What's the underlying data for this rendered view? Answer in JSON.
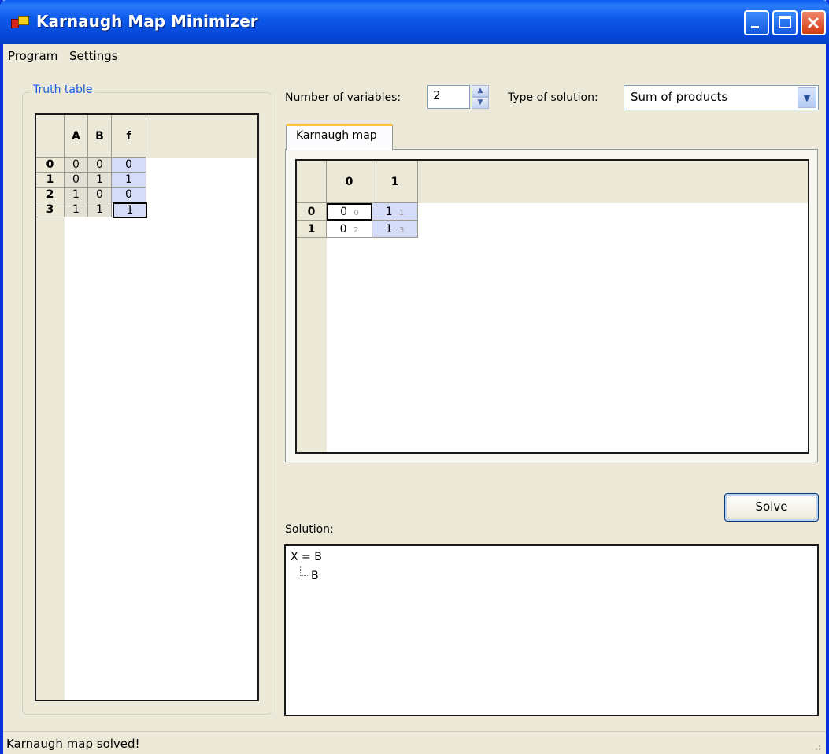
{
  "window": {
    "title": "Karnaugh Map Minimizer"
  },
  "menu": {
    "items": [
      {
        "label": "Program",
        "accel": "P",
        "rest": "rogram"
      },
      {
        "label": "Settings",
        "accel": "S",
        "rest": "ettings"
      }
    ]
  },
  "truth_table": {
    "legend": "Truth table",
    "columns": [
      "A",
      "B",
      "f"
    ],
    "rows": [
      {
        "index": "0",
        "a": "0",
        "b": "0",
        "f": "0"
      },
      {
        "index": "1",
        "a": "0",
        "b": "1",
        "f": "1"
      },
      {
        "index": "2",
        "a": "1",
        "b": "0",
        "f": "0"
      },
      {
        "index": "3",
        "a": "1",
        "b": "1",
        "f": "1"
      }
    ]
  },
  "controls": {
    "num_vars_label": "Number of variables:",
    "num_vars_value": "2",
    "solution_type_label": "Type of solution:",
    "solution_type_value": "Sum of products"
  },
  "kmap": {
    "tab_label": "Karnaugh map",
    "col_headers": [
      "0",
      "1"
    ],
    "rows": [
      {
        "header": "0",
        "cells": [
          {
            "value": "0",
            "index": "0"
          },
          {
            "value": "1",
            "index": "1"
          }
        ]
      },
      {
        "header": "1",
        "cells": [
          {
            "value": "0",
            "index": "2"
          },
          {
            "value": "1",
            "index": "3"
          }
        ]
      }
    ]
  },
  "solve_label": "Solve",
  "solution": {
    "label": "Solution:",
    "root": "X = B",
    "child": "B"
  },
  "status": "Karnaugh map solved!",
  "colors": {
    "title_bar": "#0a5bf0",
    "accent_blue": "#d5dcf7",
    "legend_text": "#1c5be0",
    "tab_highlight": "#ffc83c"
  }
}
